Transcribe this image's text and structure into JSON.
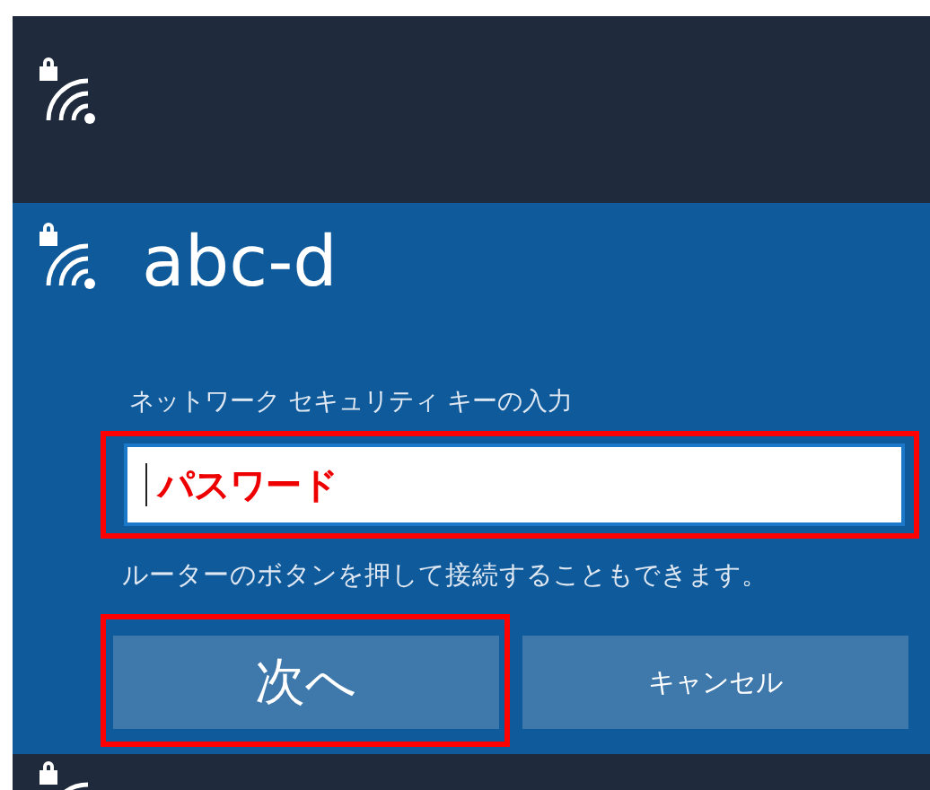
{
  "networks": [
    {
      "kind": "collapsed",
      "secured": true
    },
    {
      "kind": "expanded",
      "secured": true,
      "name": "abc-d",
      "key_label": "ネットワーク セキュリティ キーの入力",
      "password_field": {
        "value": "パスワード",
        "highlighted": true
      },
      "hint": "ルーターのボタンを押して接続することもできます。",
      "buttons": [
        {
          "kind": "primary",
          "label": "次へ",
          "highlighted": true
        },
        {
          "kind": "secondary",
          "label": "キャンセル",
          "highlighted": false
        }
      ]
    },
    {
      "kind": "collapsed",
      "secured": true
    }
  ]
}
